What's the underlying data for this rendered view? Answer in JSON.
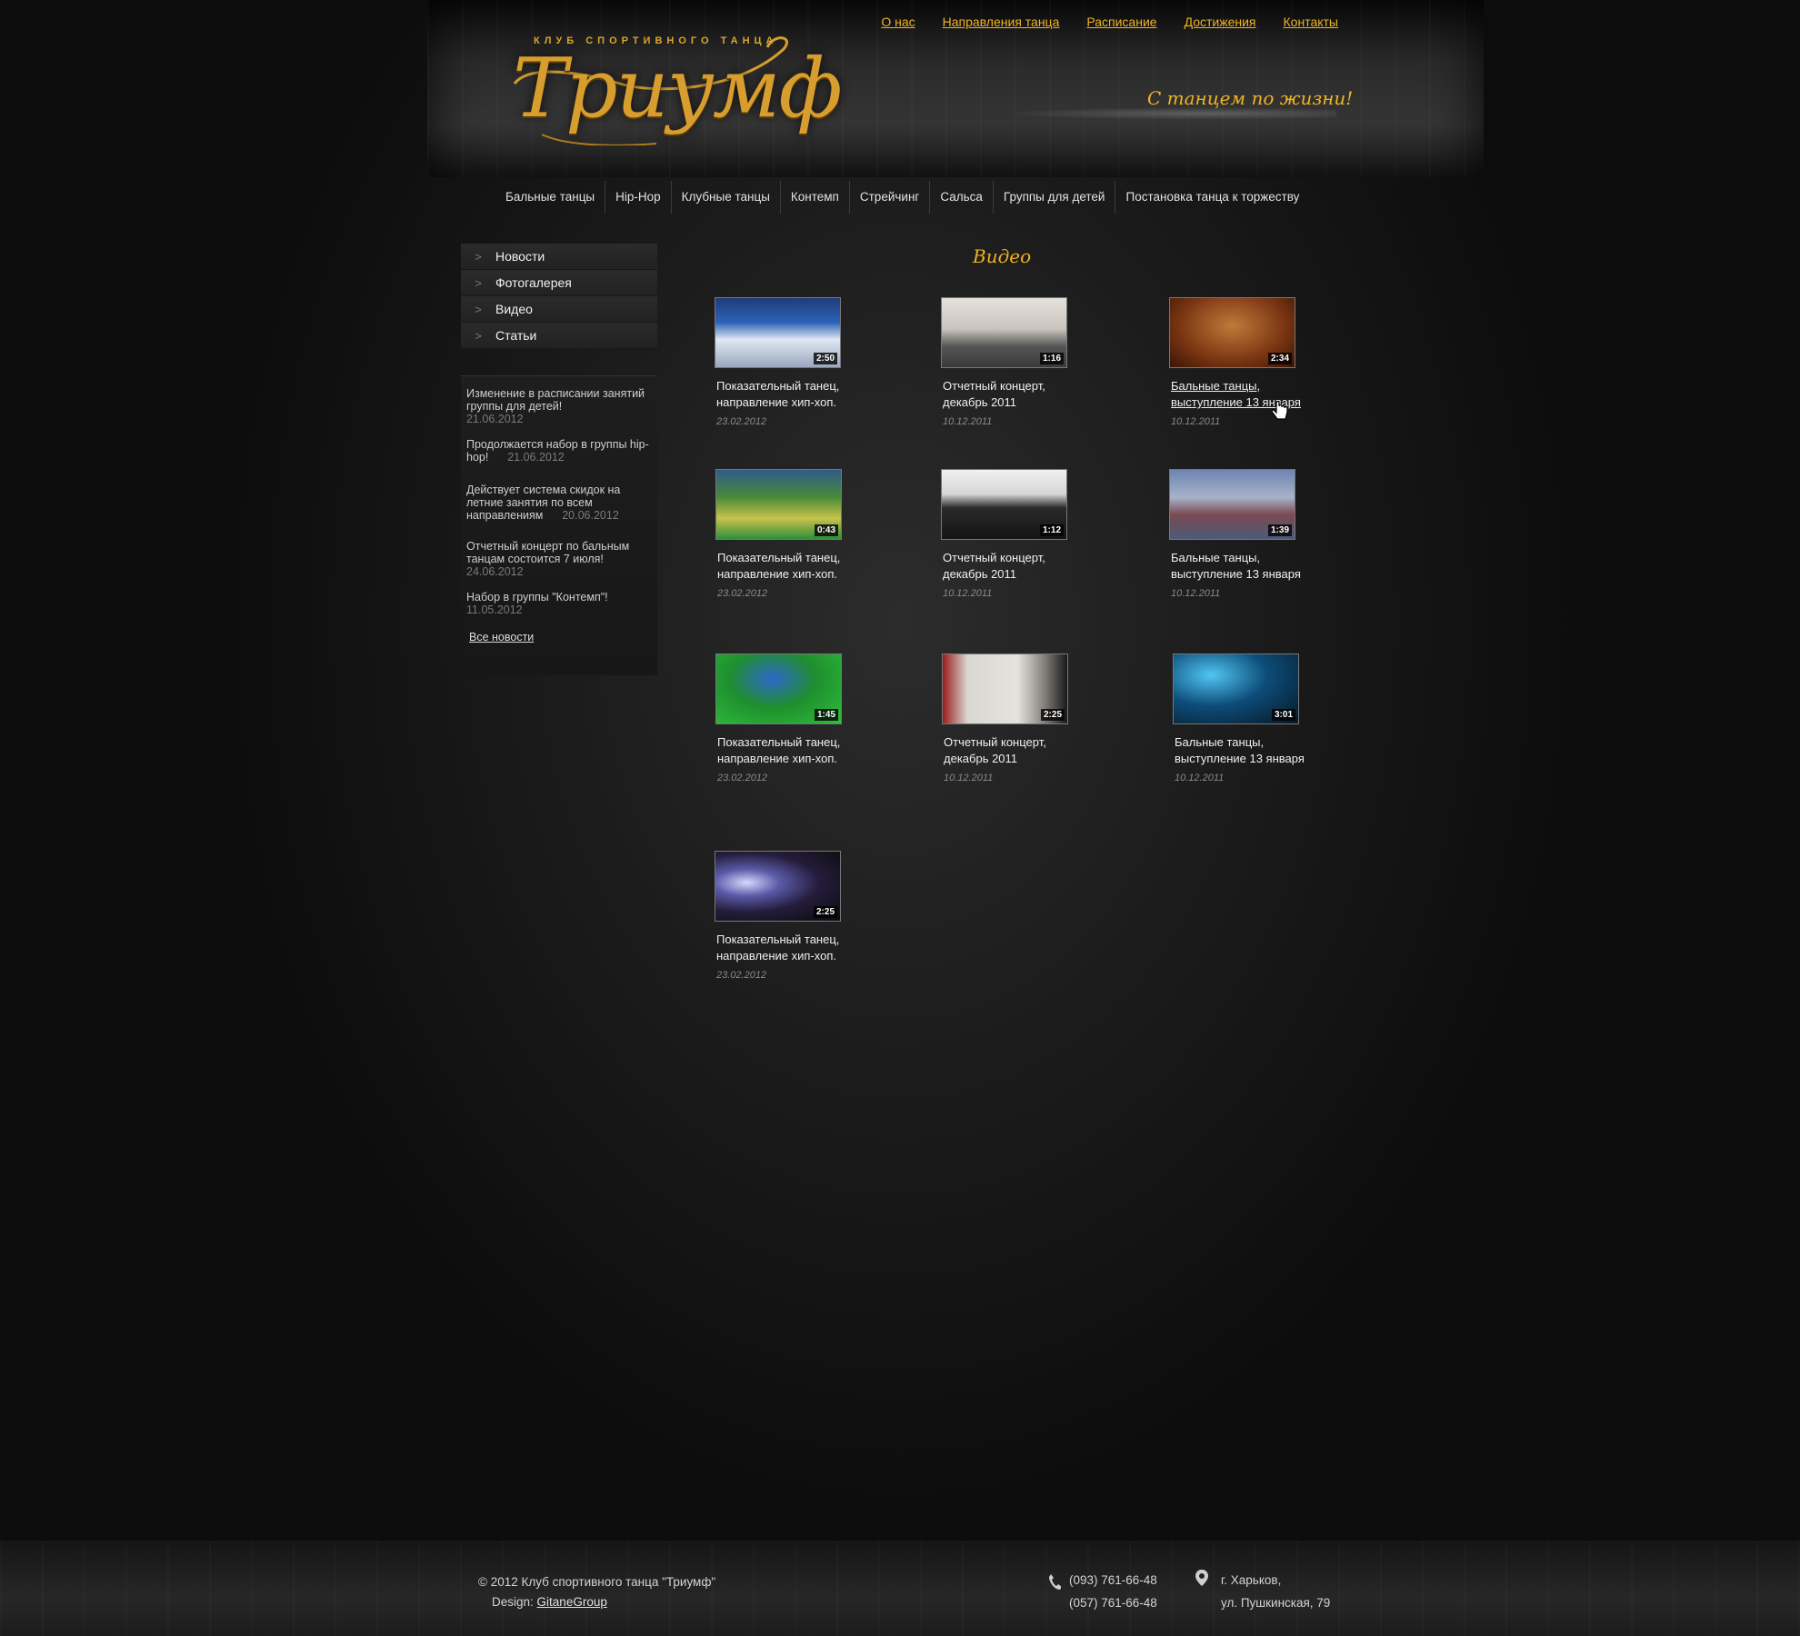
{
  "header": {
    "logo_subtitle": "КЛУБ СПОРТИВНОГО ТАНЦА",
    "logo_title": "Триумф",
    "slogan": "С танцем по жизни!",
    "topnav": [
      "О нас",
      "Направления танца",
      "Расписание",
      "Достижения",
      "Контакты"
    ]
  },
  "mainnav": [
    "Бальные танцы",
    "Hip-Hop",
    "Клубные танцы",
    "Контемп",
    "Стрейчинг",
    "Сальса",
    "Группы для детей",
    "Постановка танца к торжеству"
  ],
  "sidebar": {
    "menu": [
      "Новости",
      "Фотогалерея",
      "Видео",
      "Статьи"
    ],
    "news": [
      {
        "text": "Изменение в расписании занятий группы для детей!",
        "date": "21.06.2012"
      },
      {
        "text": "Продолжается набор в группы hip-hop!",
        "date": "21.06.2012"
      },
      {
        "text": "Действует система скидок на летние занятия по всем направлениям",
        "date": "20.06.2012"
      },
      {
        "text": "Отчетный концерт по бальным танцам состоится 7 июля!",
        "date": "24.06.2012"
      },
      {
        "text": "Набор в группы \"Контемп\"!",
        "date": "11.05.2012"
      }
    ],
    "all_news": "Все новости"
  },
  "content": {
    "title": "Видео",
    "videos": [
      {
        "duration": "2:50",
        "title_1": "Показательный танец,",
        "title_2": "направление хип-хоп.",
        "date": "23.02.2012"
      },
      {
        "duration": "1:16",
        "title_1": "Отчетный концерт,",
        "title_2": "декабрь 2011",
        "date": "10.12.2011"
      },
      {
        "duration": "2:34",
        "title_1": "Бальные танцы,",
        "title_2": "выступление 13 января",
        "date": "10.12.2011"
      },
      {
        "duration": "0:43",
        "title_1": "Показательный танец,",
        "title_2": "направление хип-хоп.",
        "date": "23.02.2012"
      },
      {
        "duration": "1:12",
        "title_1": "Отчетный концерт,",
        "title_2": "декабрь 2011",
        "date": "10.12.2011"
      },
      {
        "duration": "1:39",
        "title_1": "Бальные танцы,",
        "title_2": "выступление 13 января",
        "date": "10.12.2011"
      },
      {
        "duration": "1:45",
        "title_1": "Показательный танец,",
        "title_2": "направление хип-хоп.",
        "date": "23.02.2012"
      },
      {
        "duration": "2:25",
        "title_1": "Отчетный концерт,",
        "title_2": "декабрь 2011",
        "date": "10.12.2011"
      },
      {
        "duration": "3:01",
        "title_1": "Бальные танцы,",
        "title_2": "выступление 13 января",
        "date": "10.12.2011"
      },
      {
        "duration": "2:25",
        "title_1": "Показательный танец,",
        "title_2": "направление хип-хоп.",
        "date": "23.02.2012"
      }
    ]
  },
  "footer": {
    "copyright": "© 2012 Клуб спортивного танца \"Триумф\"",
    "design_label": "Design:",
    "design_link": "GitaneGroup",
    "phone_1": "(093) 761-66-48",
    "phone_2": "(057) 761-66-48",
    "city": "г. Харьков,",
    "street": "ул. Пушкинская, 79"
  },
  "colors": {
    "accent": "#f0b323",
    "logo": "#d79e2f",
    "background": "#1d1d1d"
  }
}
